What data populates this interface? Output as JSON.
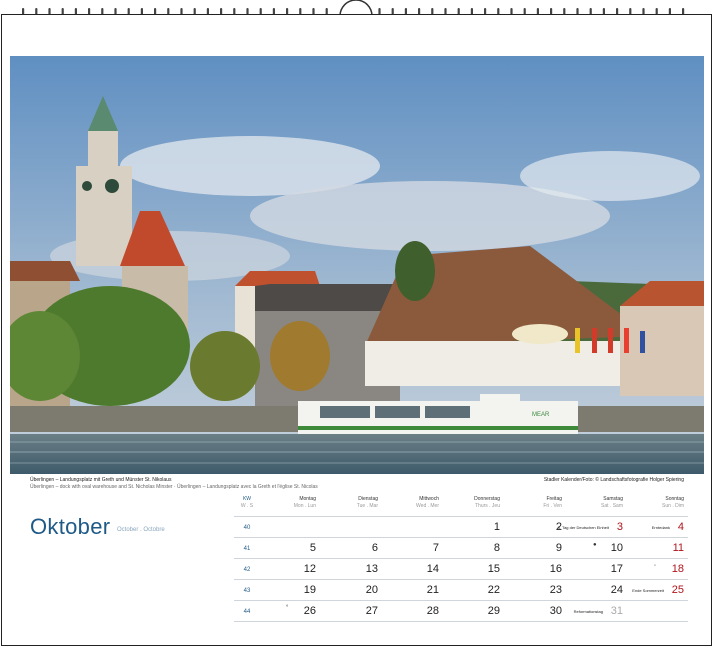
{
  "calendar": {
    "month": "Oktober",
    "month_sub": "October . Octobre",
    "kw_label": "KW",
    "kw_sub": "W . S",
    "days": [
      {
        "name": "Montag",
        "sub": "Mon . Lun"
      },
      {
        "name": "Dienstag",
        "sub": "Tue . Mar"
      },
      {
        "name": "Mittwoch",
        "sub": "Wed . Mer"
      },
      {
        "name": "Donnerstag",
        "sub": "Thurs . Jeu"
      },
      {
        "name": "Freitag",
        "sub": "Fri . Ven"
      },
      {
        "name": "Samstag",
        "sub": "Sat . Sam"
      },
      {
        "name": "Sonntag",
        "sub": "Sun . Dim"
      }
    ],
    "weeks": [
      {
        "kw": "40",
        "d": [
          "",
          "",
          "",
          "1",
          "2",
          "3",
          "4"
        ],
        "notes": [
          "",
          "",
          "",
          "",
          "",
          "3. Tag der Deutschen Einheit",
          "Erntedank"
        ]
      },
      {
        "kw": "41",
        "d": [
          "5",
          "6",
          "7",
          "8",
          "9",
          "10",
          "11"
        ],
        "notes": [
          "",
          "",
          "",
          "",
          "",
          "",
          ""
        ]
      },
      {
        "kw": "42",
        "d": [
          "12",
          "13",
          "14",
          "15",
          "16",
          "17",
          "18"
        ],
        "notes": [
          "",
          "",
          "",
          "",
          "",
          "",
          ""
        ]
      },
      {
        "kw": "43",
        "d": [
          "19",
          "20",
          "21",
          "22",
          "23",
          "24",
          "25"
        ],
        "notes": [
          "",
          "",
          "",
          "",
          "",
          "",
          "Ende Sommerzeit"
        ]
      },
      {
        "kw": "44",
        "d": [
          "26",
          "27",
          "28",
          "29",
          "30",
          "31",
          ""
        ],
        "notes": [
          "",
          "",
          "",
          "",
          "",
          "Reformationstag",
          ""
        ]
      }
    ]
  },
  "photo": {
    "caption_title": "Überlingen – Landungsplatz mit Greth und Münster St. Nikolaus",
    "caption_sub": "Überlingen – dock with oval warehouse and St. Nicholas Minster · Überlingen – Landungsplatz avec la Greth et l'église St. Nicolas",
    "credit": "Stadler Kalender/Foto: © Landschaftsfotografie Holger Spiering",
    "boat_name": "MEAR"
  },
  "colors": {
    "month_blue": "#1f5a87",
    "sunday_red": "#b0141c"
  }
}
